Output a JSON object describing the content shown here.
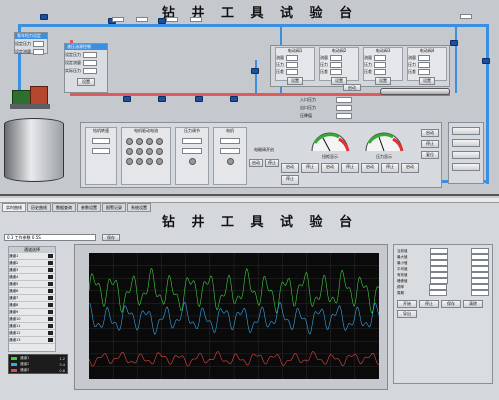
{
  "top": {
    "title": "钻 井 工 具 试 验 台",
    "left_box1": {
      "header": "泵车恒力设定",
      "rows": [
        "设定压力",
        "设定流量"
      ]
    },
    "left_box2": {
      "header": "液压油源控制",
      "rows": [
        "设定压力",
        "设定流量",
        "实际压力"
      ],
      "button": "设置"
    },
    "flow_panels": [
      {
        "header": "电动阀1",
        "rows": [
          "流量",
          "压力",
          "压差"
        ],
        "button": "设置"
      },
      {
        "header": "电动阀2",
        "rows": [
          "流量",
          "压力",
          "压差"
        ],
        "button": "设置"
      },
      {
        "header": "电动阀3",
        "rows": [
          "流量",
          "压力",
          "压差"
        ],
        "button": "设置"
      },
      {
        "header": "电动阀4",
        "rows": [
          "流量",
          "压力",
          "压差"
        ],
        "button": "设置"
      }
    ],
    "tool_btn": "启动",
    "tool_rows": [
      "入口压力",
      "出口压力",
      "压降值"
    ],
    "bottom_panel": {
      "groups": [
        "钻机转速",
        "电机驱动电流",
        "压力调节",
        "电机",
        "电磁阀开启",
        "工具电机"
      ],
      "gauge1_label": "扭矩显示",
      "gauge2_label": "压力显示",
      "buttons": [
        "启动",
        "停止",
        "启动",
        "停止",
        "启动",
        "停止",
        "启动",
        "停止",
        "启动",
        "停止"
      ],
      "side_buttons": [
        "启动",
        "停止",
        "复位"
      ]
    }
  },
  "bottom": {
    "title": "钻 井 工 具 试 验 台",
    "tabs": [
      "实时曲线",
      "历史曲线",
      "数据查询",
      "参数设置",
      "报警记录",
      "系统设置"
    ],
    "combo": "0.1 工作参数 0.5S",
    "action_btn": "保存",
    "list_header": "通道选择",
    "channels": [
      "通道1",
      "通道2",
      "通道3",
      "通道4",
      "通道5",
      "通道6",
      "通道7",
      "通道8",
      "通道9",
      "通道10",
      "通道11",
      "通道12",
      "通道13"
    ],
    "legend": [
      {
        "name": "通道1",
        "value": "1.2"
      },
      {
        "name": "通道2",
        "value": "3.4"
      },
      {
        "name": "通道3",
        "value": "0.8"
      }
    ],
    "right_rows": [
      "当前值",
      "最大值",
      "最小值",
      "平均值",
      "有效值",
      "峰峰值",
      "频率",
      "周期"
    ],
    "right_buttons": [
      "开始",
      "停止",
      "保存",
      "清除",
      "导出"
    ],
    "colors": {
      "green": "#3fcf3f",
      "blue": "#3aa6e8",
      "red": "#e04848",
      "plot_bg": "#0a0a0a"
    }
  },
  "chart_data": {
    "type": "line",
    "title": "",
    "xlabel": "",
    "ylabel": "",
    "ylim": [
      0,
      10
    ],
    "series": [
      {
        "color": "#3fcf3f",
        "base": 7,
        "amp": 1.8
      },
      {
        "color": "#3aa6e8",
        "base": 4.8,
        "amp": 1.3
      },
      {
        "color": "#e04848",
        "base": 1.6,
        "amp": 0.6
      }
    ]
  }
}
